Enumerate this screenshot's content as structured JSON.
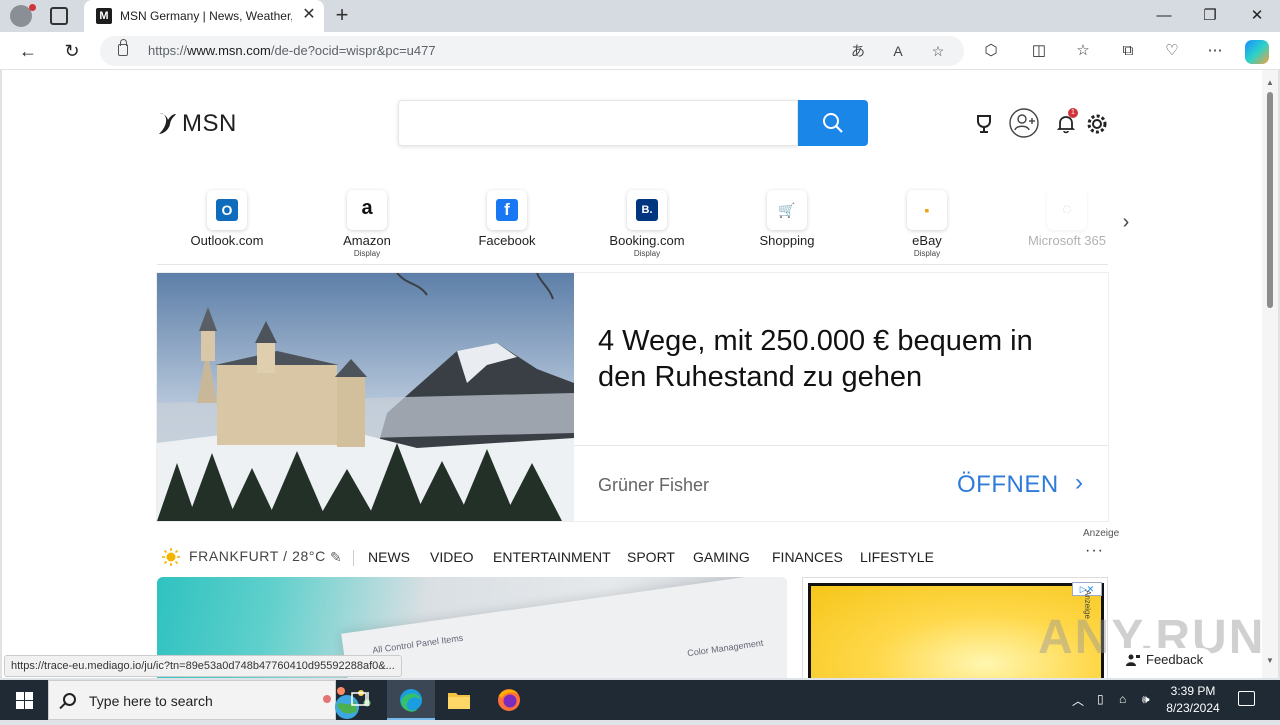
{
  "browser": {
    "tab_title": "MSN Germany | News, Weather, Traffic",
    "favicon_letter": "M",
    "url_prefix": "https://",
    "url_host": "www.msn.com",
    "url_path": "/de-de?ocid=wispr&pc=u477",
    "window_controls": [
      "—",
      "❐",
      "✕"
    ]
  },
  "msn": {
    "logo_text": "MSN",
    "search_placeholder": "",
    "notification_count": "1"
  },
  "quick_links": [
    {
      "label": "Outlook.com",
      "sub": "",
      "color": "#0f6cbd",
      "glyph": "O"
    },
    {
      "label": "Amazon",
      "sub": "Display",
      "color": "#ffffff",
      "glyph": "a"
    },
    {
      "label": "Facebook",
      "sub": "",
      "color": "#1877f2",
      "glyph": "f"
    },
    {
      "label": "Booking.com",
      "sub": "Display",
      "color": "#003580",
      "glyph": "B."
    },
    {
      "label": "Shopping",
      "sub": "",
      "color": "#ffffff",
      "glyph": "🛒"
    },
    {
      "label": "eBay",
      "sub": "Display",
      "color": "#ffffff",
      "glyph": "▪"
    },
    {
      "label": "Microsoft 365",
      "sub": "",
      "color": "#e8eef6",
      "glyph": "◌"
    }
  ],
  "hero": {
    "headline": "4 Wege, mit 250.000 € bequem in den Ruhestand zu gehen",
    "sponsor": "Grüner Fisher",
    "cta": "ÖFFNEN",
    "ad_label": "Anzeige"
  },
  "navbar": {
    "weather": "FRANKFURT / 28°C",
    "items": [
      "NEWS",
      "VIDEO",
      "ENTERTAINMENT",
      "SPORT",
      "GAMING",
      "FINANCES",
      "LIFESTYLE"
    ]
  },
  "card": {
    "panel_text_1": "All Control Panel Items",
    "panel_text_2": "Color Management",
    "ad_vertical": "Anzeige",
    "adchoice": "▷✕"
  },
  "feedback_label": "Feedback",
  "watermark": "ANY.RUN",
  "status_url": "https://trace-eu.mediago.io/ju/ic?tn=89e53a0d748b47760410d95592288af0&...",
  "taskbar": {
    "search_placeholder": "Type here to search",
    "time": "3:39 PM",
    "date": "8/23/2024"
  },
  "colors": {
    "accent": "#1a86e8",
    "cta": "#2f7bd8",
    "taskbar": "#1f2a35"
  }
}
